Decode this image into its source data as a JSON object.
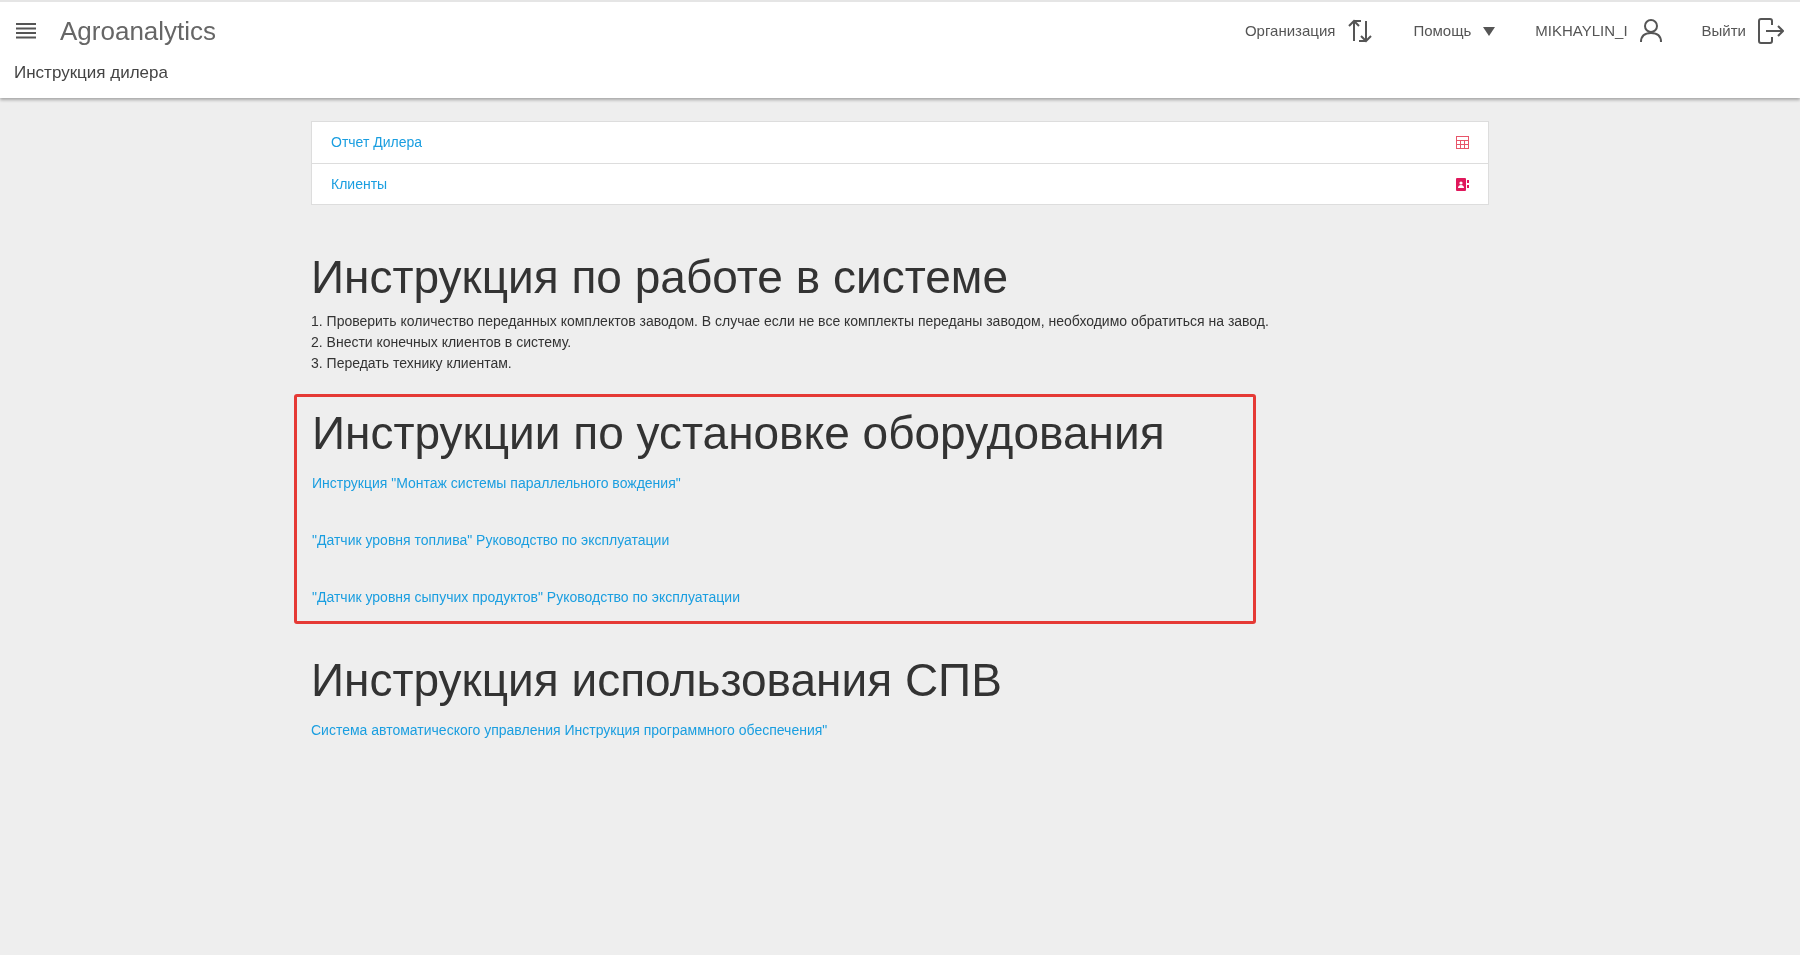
{
  "header": {
    "title": "Agroanalytics",
    "subtitle": "Инструкция дилера",
    "actions": [
      {
        "kind": "org",
        "label": "Организация"
      },
      {
        "kind": "help",
        "label": "Помощь"
      },
      {
        "kind": "user",
        "label": "MIKHAYLIN_I"
      },
      {
        "kind": "logout",
        "label": "Выйти"
      }
    ]
  },
  "menu_list": [
    {
      "label": "Отчет Дилера",
      "kind": "table"
    },
    {
      "label": "Клиенты",
      "kind": "contacts"
    }
  ],
  "sections": [
    {
      "heading": "Инструкция по работе в системе",
      "highlighted": false,
      "items": [
        {
          "kind": "text",
          "text": "1. Проверить количество переданных комплектов заводом. В случае если не все комплекты переданы заводом, необходимо обратиться на завод."
        },
        {
          "kind": "text",
          "text": "2. Внести конечных клиентов в систему."
        },
        {
          "kind": "text",
          "text": "3. Передать технику клиентам."
        }
      ]
    },
    {
      "heading": "Инструкции по установке оборудования",
      "highlighted": true,
      "items": [
        {
          "kind": "link",
          "text": "Инструкция \"Монтаж системы параллельного вождения\""
        },
        {
          "kind": "link",
          "text": "\"Датчик уровня топлива\" Руководство по эксплуатации"
        },
        {
          "kind": "link",
          "text": "\"Датчик уровня сыпучих продуктов\" Руководство по эксплуатации"
        }
      ]
    },
    {
      "heading": "Инструкция использования СПВ",
      "highlighted": false,
      "items": [
        {
          "kind": "link",
          "text": "Система автоматического управления Инструкция программного обеспечения\""
        }
      ]
    }
  ]
}
